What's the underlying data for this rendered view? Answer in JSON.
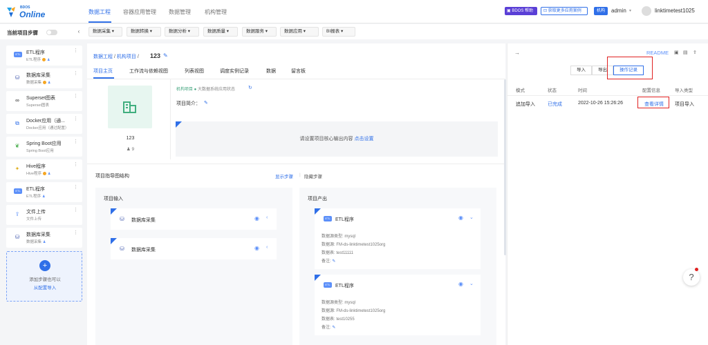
{
  "app": {
    "brand_small": "BDOS",
    "brand": "Online"
  },
  "topnav": {
    "tabs": [
      "数据工程",
      "容器应用管理",
      "数据管理",
      "机构管理"
    ],
    "help_label": "BDOS 帮助",
    "cases_label": "获取更多应用案例",
    "org_badge": "机构",
    "admin_label": "admin",
    "username": "linktimetest1025"
  },
  "subbar": {
    "current_step_label": "当前项目步骤",
    "menus": [
      "数据采集",
      "数据转换",
      "数据分析",
      "数据质量",
      "数据服务",
      "数据应用",
      "BI报表"
    ]
  },
  "steps": [
    {
      "title": "ETL程序",
      "sub": "ETL程序",
      "icon": "etl-icon",
      "dots": "ob"
    },
    {
      "title": "数据库采集",
      "sub": "数据采集",
      "icon": "database-icon",
      "dots": "ob"
    },
    {
      "title": "Superset图表",
      "sub": "Superset图表",
      "icon": "infinity-icon",
      "dots": ""
    },
    {
      "title": "Docker应用（通...",
      "sub": "Docker应用（通过配置）",
      "icon": "docker-icon",
      "dots": ""
    },
    {
      "title": "Spring Boot应用",
      "sub": "Spring Boot应用",
      "icon": "spring-icon",
      "dots": ""
    },
    {
      "title": "Hive程序",
      "sub": "Hive程序",
      "icon": "hive-icon",
      "dots": "ob"
    },
    {
      "title": "ETL程序",
      "sub": "ETL程序",
      "icon": "etl-icon",
      "dots": "b"
    },
    {
      "title": "文件上传",
      "sub": "文件上传",
      "icon": "upload-icon",
      "dots": ""
    },
    {
      "title": "数据库采集",
      "sub": "数据采集",
      "icon": "database-icon",
      "dots": "b"
    }
  ],
  "add_step": {
    "line1": "添加步骤也可以",
    "line2": "从配置导入"
  },
  "main": {
    "breadcrumb_1": "数据工程",
    "breadcrumb_sep": "/",
    "breadcrumb_2": "机构项目",
    "title": "123",
    "tabs": [
      "项目主页",
      "工作流与依赖视图",
      "列表视图",
      "调度实例记录",
      "数据",
      "留言板"
    ],
    "project_name": "123",
    "member_count": "9",
    "meta_org": "机构项目",
    "meta_status": "大数据系统应用状态",
    "intro_label": "项目简介：",
    "core_text": "请设置项目核心输出内容",
    "core_link": "点击设置",
    "guide_label": "项目指导图结构",
    "show_steps": "显示步骤",
    "sep": "|",
    "hide_steps": "隐藏步骤",
    "input_label": "项目输入",
    "output_label": "项目产出",
    "inputs": [
      {
        "label": "数据库采集"
      },
      {
        "label": "数据库采集"
      }
    ],
    "outputs": [
      {
        "label": "ETL程序",
        "type": "数据源类型: mysql",
        "src": "数据源: FM-ds-linktimetest1025org",
        "table": "数据表: test11111",
        "note": "备注:"
      },
      {
        "label": "ETL程序",
        "type": "数据源类型: mysql",
        "src": "数据源: FM-ds-linktimetest1025org",
        "table": "数据表: test10255",
        "note": "备注:"
      }
    ]
  },
  "right": {
    "readme": "README",
    "btn_import": "导入",
    "btn_export": "导出",
    "btn_oplog": "操作记录",
    "headers": [
      "模式",
      "状态",
      "时间",
      "配置信息",
      "导入类型"
    ],
    "row": {
      "mode": "追加导入",
      "status": "已完成",
      "time": "2022-10-26 15:26:26",
      "detail": "查看详情",
      "import_type": "项目导入"
    }
  },
  "colors": {
    "accent": "#2f6fe8",
    "highlight": "#e02020",
    "help": "#5a3fd6"
  }
}
